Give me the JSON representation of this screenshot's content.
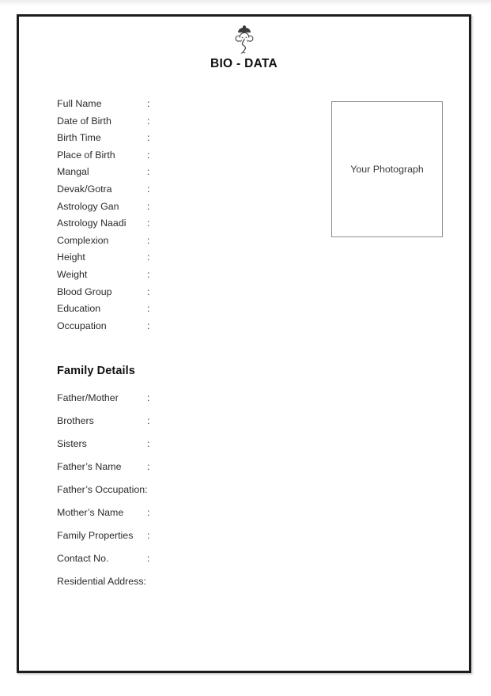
{
  "document": {
    "title": "BIO - DATA",
    "deity_icon": "ganesha-icon"
  },
  "personal_details": {
    "rows": [
      {
        "label": "Full Name",
        "separator": ":",
        "value": ""
      },
      {
        "label": "Date of Birth",
        "separator": ":",
        "value": ""
      },
      {
        "label": "Birth Time",
        "separator": ":",
        "value": ""
      },
      {
        "label": "Place of Birth",
        "separator": ":",
        "value": ""
      },
      {
        "label": "Mangal",
        "separator": ":",
        "value": ""
      },
      {
        "label": "Devak/Gotra",
        "separator": ":",
        "value": ""
      },
      {
        "label": "Astrology Gan",
        "separator": ":",
        "value": ""
      },
      {
        "label": "Astrology Naadi",
        "separator": ":",
        "value": ""
      },
      {
        "label": "Complexion",
        "separator": ":",
        "value": ""
      },
      {
        "label": "Height",
        "separator": ":",
        "value": ""
      },
      {
        "label": "Weight",
        "separator": ":",
        "value": ""
      },
      {
        "label": "Blood Group",
        "separator": ":",
        "value": ""
      },
      {
        "label": "Education",
        "separator": ":",
        "value": ""
      },
      {
        "label": "Occupation",
        "separator": ":",
        "value": ""
      }
    ]
  },
  "family_details": {
    "heading": "Family Details",
    "rows": [
      {
        "label": "Father/Mother",
        "separator": ":",
        "value": ""
      },
      {
        "label": "Brothers",
        "separator": ":",
        "value": ""
      },
      {
        "label": "Sisters",
        "separator": ":",
        "value": ""
      },
      {
        "label": "Father’s Name",
        "separator": ":",
        "value": ""
      },
      {
        "label": "Father’s Occupation",
        "separator": ":",
        "value": ""
      },
      {
        "label": "Mother’s Name",
        "separator": ":",
        "value": ""
      },
      {
        "label": "Family Properties",
        "separator": ":",
        "value": ""
      },
      {
        "label": "Contact No.",
        "separator": ":",
        "value": ""
      },
      {
        "label": "Residential Address",
        "separator": ":",
        "value": ""
      }
    ]
  },
  "photo": {
    "caption": "Your Photograph"
  },
  "colors": {
    "page_border": "#1d1d1d",
    "text": "#2b2b2b",
    "heading": "#111111",
    "photo_border": "#8d8d8d",
    "page_background": "#ffffff"
  }
}
